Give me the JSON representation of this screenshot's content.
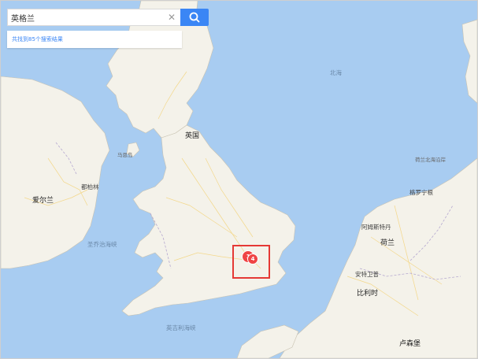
{
  "search": {
    "query": "英格兰",
    "clear_icon": "close-icon",
    "search_icon": "search-icon"
  },
  "results": {
    "summary": "共找到85个搜索结果"
  },
  "marker": {
    "count": "1",
    "badge": "4"
  },
  "labels": {
    "beihai": "北海",
    "yingguo": "英国",
    "madao": "马恩岛",
    "aierlan": "爱尔兰",
    "dubolin": "都柏林",
    "holland_coast": "荷兰北海沿岸",
    "geluoningen": "格罗宁根",
    "amsterdam": "阿姆斯特丹",
    "helan": "荷兰",
    "antwerp": "安特卫普",
    "bilishi": "比利时",
    "lusenbao": "卢森堡",
    "bristol_channel": "圣乔治海峡",
    "english_channel": "英吉利海峡"
  },
  "colors": {
    "sea": "#a8ccf1",
    "land": "#f4f2ea",
    "accent": "#3a86f5",
    "marker": "#ef4444",
    "highlight": "#e53935"
  }
}
